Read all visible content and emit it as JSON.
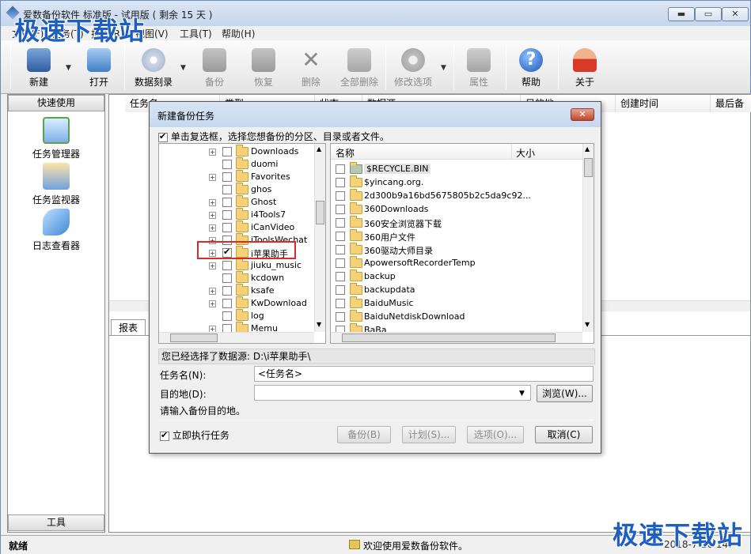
{
  "app": {
    "title": "爱数备份软件 标准版 - 试用版 ( 剩余 15 天 )"
  },
  "menu": [
    "文件(F)",
    "任务(T)",
    "报表(R)",
    "视图(V)",
    "工具(T)",
    "帮助(H)"
  ],
  "toolbar": {
    "new": "新建",
    "open": "打开",
    "burn": "数据刻录",
    "backup": "备份",
    "restore": "恢复",
    "delete": "删除",
    "delete_all": "全部删除",
    "modify": "修改选项",
    "properties": "属性",
    "help": "帮助",
    "about": "关于"
  },
  "left": {
    "header": "快速使用",
    "items": [
      "任务管理器",
      "任务监视器",
      "日志查看器"
    ],
    "footer": "工具"
  },
  "table": {
    "columns": [
      "任务名",
      "类型",
      "状态",
      "数据源",
      "目的地",
      "创建时间",
      "最后备"
    ]
  },
  "report_tab": "报表",
  "status": {
    "left": "就绪",
    "message": "欢迎使用爱数备份软件。",
    "time": "2018-7-10 14:"
  },
  "watermark": "极速下载站",
  "dialog": {
    "title": "新建备份任务",
    "instruction": "单击复选框，选择您想备份的分区、目录或者文件。",
    "tree": [
      {
        "name": "Downloads",
        "expand": true,
        "checked": false
      },
      {
        "name": "duomi",
        "expand": false,
        "checked": false
      },
      {
        "name": "Favorites",
        "expand": true,
        "checked": false
      },
      {
        "name": "ghos",
        "expand": false,
        "checked": false
      },
      {
        "name": "Ghost",
        "expand": true,
        "checked": false
      },
      {
        "name": "i4Tools7",
        "expand": true,
        "checked": false
      },
      {
        "name": "iCanVideo",
        "expand": true,
        "checked": false
      },
      {
        "name": "iToolsWechat",
        "expand": true,
        "checked": false
      },
      {
        "name": "i苹果助手",
        "expand": true,
        "checked": true
      },
      {
        "name": "jiuku_music",
        "expand": true,
        "checked": false
      },
      {
        "name": "kcdown",
        "expand": false,
        "checked": false
      },
      {
        "name": "ksafe",
        "expand": true,
        "checked": false
      },
      {
        "name": "KwDownload",
        "expand": true,
        "checked": false
      },
      {
        "name": "log",
        "expand": false,
        "checked": false
      },
      {
        "name": "Memu",
        "expand": true,
        "checked": false
      }
    ],
    "list_headers": {
      "name": "名称",
      "size": "大小"
    },
    "files": [
      "$RECYCLE.BIN",
      "$yincang.org.",
      "2d300b9a16bd5675805b2c5da9c92...",
      "360Downloads",
      "360安全浏览器下载",
      "360用户文件",
      "360驱动大师目录",
      "ApowersoftRecorderTemp",
      "backup",
      "backupdata",
      "BaiduMusic",
      "BaiduNetdiskDownload",
      "BaBa"
    ],
    "selected_source_label": "您已经选择了数据源:",
    "selected_source": "D:\\i苹果助手\\",
    "task_name_label": "任务名(N):",
    "task_name_value": "<任务名>",
    "dest_label": "目的地(D):",
    "browse": "浏览(W)...",
    "hint": "请输入备份目的地。",
    "run_now": "立即执行任务",
    "buttons": {
      "backup": "备份(B)",
      "schedule": "计划(S)...",
      "options": "选项(O)...",
      "cancel": "取消(C)"
    }
  }
}
